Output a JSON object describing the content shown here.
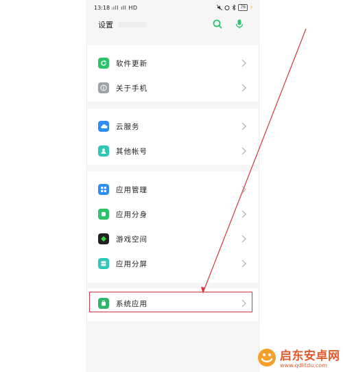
{
  "status_bar": {
    "time": "13:18",
    "signal": "ᵢıll ıll HD",
    "battery": "76"
  },
  "header": {
    "title": "设置"
  },
  "groups": [
    {
      "items": [
        {
          "label": "软件更新",
          "icon": "software-update-icon",
          "color": "#2cc36b"
        },
        {
          "label": "关于手机",
          "icon": "about-phone-icon",
          "color": "#9ea3a8"
        }
      ]
    },
    {
      "items": [
        {
          "label": "云服务",
          "icon": "cloud-service-icon",
          "color": "#2f8ff0"
        },
        {
          "label": "其他帐号",
          "icon": "other-accounts-icon",
          "color": "#2ec7b8"
        }
      ]
    },
    {
      "items": [
        {
          "label": "应用管理",
          "icon": "app-management-icon",
          "color": "#2f8ff0"
        },
        {
          "label": "应用分身",
          "icon": "app-clone-icon",
          "color": "#2cc36b"
        },
        {
          "label": "游戏空间",
          "icon": "game-space-icon",
          "color": "#222222"
        },
        {
          "label": "应用分屏",
          "icon": "split-screen-icon",
          "color": "#2ec7b8"
        }
      ]
    },
    {
      "items": [
        {
          "label": "系统应用",
          "icon": "system-apps-icon",
          "color": "#2cb56b"
        }
      ]
    }
  ],
  "watermark": {
    "name": "启东安卓网",
    "url": "www.qdlitdu.com"
  },
  "colors": {
    "accent_green": "#2cc36b",
    "highlight_red": "#d0363c"
  }
}
